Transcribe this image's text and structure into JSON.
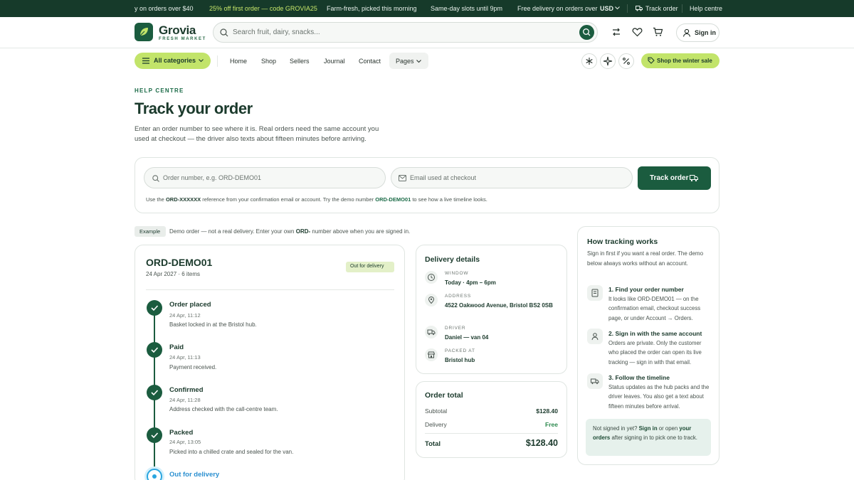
{
  "strip": {
    "promo1": "y on orders over $40",
    "promo2": "25% off first order — code GROVIA25",
    "promo3": "Farm-fresh, picked this morning",
    "promo4": "Same-day slots until 9pm",
    "promo5": "Free delivery on orders over",
    "currency": "USD",
    "track": "Track order",
    "help": "Help centre"
  },
  "brand": {
    "name": "Grovia",
    "tagline": "FRESH MARKET"
  },
  "search": {
    "placeholder": "Search fruit, dairy, snacks..."
  },
  "header": {
    "signin": "Sign in"
  },
  "nav": {
    "all_categories": "All categories",
    "links": [
      "Home",
      "Shop",
      "Sellers",
      "Journal",
      "Contact"
    ],
    "pages": "Pages",
    "sale": "Shop the winter sale"
  },
  "hero": {
    "eyebrow": "HELP CENTRE",
    "title": "Track your order",
    "lead": "Enter an order number to see where it is. Real orders need the same account you used at checkout — the driver also texts about fifteen minutes before arriving."
  },
  "form": {
    "order_placeholder": "Order number, e.g. ORD-DEMO01",
    "email_placeholder": "Email used at checkout",
    "button": "Track order",
    "hint_a": "Use the ",
    "hint_ref": "ORD-XXXXXX",
    "hint_b": " reference from your confirmation email or account. Try the demo number ",
    "hint_demo": "ORD-DEMO01",
    "hint_c": " to see how a live timeline looks."
  },
  "example": {
    "badge": "Example",
    "text_a": "Demo order — not a real delivery. Enter your own ",
    "text_b": "ORD-",
    "text_c": " number above when you are signed in."
  },
  "order": {
    "number": "ORD-DEMO01",
    "meta": "24 Apr 2027 · 6 items",
    "status": "Out for delivery",
    "timeline": [
      {
        "title": "Order placed",
        "time": "24 Apr, 11:12",
        "desc": "Basket locked in at the Bristol hub."
      },
      {
        "title": "Paid",
        "time": "24 Apr, 11:13",
        "desc": "Payment received."
      },
      {
        "title": "Confirmed",
        "time": "24 Apr, 11:28",
        "desc": "Address checked with the call-centre team."
      },
      {
        "title": "Packed",
        "time": "24 Apr, 13:05",
        "desc": "Picked into a chilled crate and sealed for the van."
      },
      {
        "title": "Out for delivery",
        "time": "",
        "desc": ""
      }
    ]
  },
  "delivery": {
    "title": "Delivery details",
    "items": [
      {
        "label": "WINDOW",
        "value": "Today · 4pm – 6pm"
      },
      {
        "label": "ADDRESS",
        "value": "4522 Oakwood Avenue, Bristol BS2 0SB"
      },
      {
        "label": "DRIVER",
        "value": "Daniel — van 04"
      },
      {
        "label": "PACKED AT",
        "value": "Bristol hub"
      }
    ]
  },
  "total": {
    "title": "Order total",
    "subtotal_label": "Subtotal",
    "subtotal": "$128.40",
    "delivery_label": "Delivery",
    "delivery": "Free",
    "total_label": "Total",
    "total": "$128.40"
  },
  "how": {
    "title": "How tracking works",
    "lead": "Sign in first if you want a real order. The demo below always works without an account.",
    "steps": [
      {
        "title": "1.  Find your order number",
        "desc": "It looks like ORD-DEMO01 — on the confirmation email, checkout success page, or under Account → Orders."
      },
      {
        "title": "2.  Sign in with the same account",
        "desc": "Orders are private. Only the customer who placed the order can open its live tracking — sign in with that email."
      },
      {
        "title": "3.  Follow the timeline",
        "desc": "Status updates as the hub packs and the driver leaves. You also get a text about fifteen minutes before arrival."
      }
    ],
    "notice_a": "Not signed in yet? ",
    "notice_b": "Sign in",
    "notice_c": " or open ",
    "notice_d": "your orders",
    "notice_e": " after signing in to pick one to track."
  },
  "colors": {
    "brand": "#1b5c3f",
    "lime": "#c2e46a",
    "current": "#2aa6e0"
  }
}
